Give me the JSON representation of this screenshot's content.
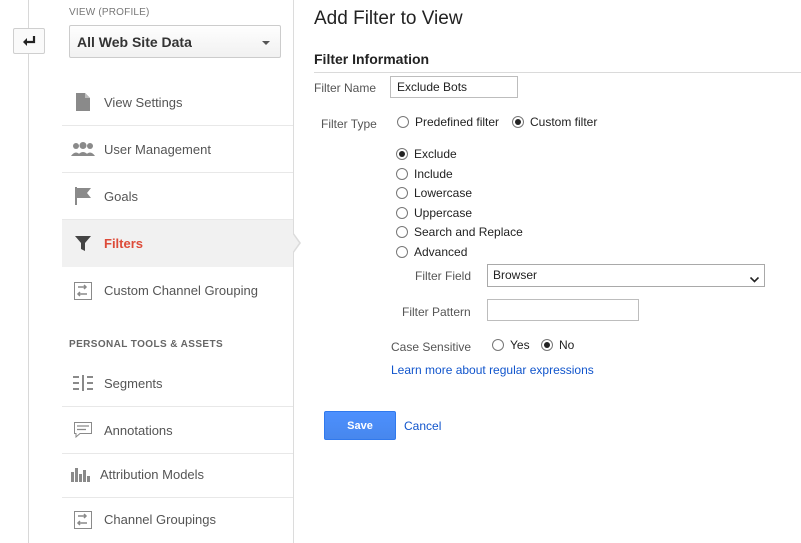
{
  "sidebar": {
    "view_label": "VIEW (PROFILE)",
    "view_selected": "All Web Site Data",
    "items": [
      {
        "label": "View Settings",
        "icon": "document-icon"
      },
      {
        "label": "User Management",
        "icon": "users-icon"
      },
      {
        "label": "Goals",
        "icon": "flag-icon"
      },
      {
        "label": "Filters",
        "icon": "funnel-icon"
      },
      {
        "label": "Custom Channel Grouping",
        "icon": "channel-grouping-icon"
      }
    ],
    "section_heading": "PERSONAL TOOLS & ASSETS",
    "tools": [
      {
        "label": "Segments",
        "icon": "segments-icon"
      },
      {
        "label": "Annotations",
        "icon": "annotation-icon"
      },
      {
        "label": "Attribution Models",
        "icon": "bar-chart-icon"
      },
      {
        "label": "Channel Groupings",
        "icon": "channel-grouping-icon"
      }
    ],
    "active_color": "#dd4b39"
  },
  "main": {
    "title": "Add Filter to View",
    "section_title": "Filter Information",
    "filter_name_label": "Filter Name",
    "filter_name_value": "Exclude Bots",
    "filter_type_label": "Filter Type",
    "filter_type_options": [
      "Predefined filter",
      "Custom filter"
    ],
    "custom_options": [
      "Exclude",
      "Include",
      "Lowercase",
      "Uppercase",
      "Search and Replace",
      "Advanced"
    ],
    "filter_field_label": "Filter Field",
    "filter_field_value": "Browser",
    "filter_pattern_label": "Filter Pattern",
    "filter_pattern_value": "",
    "case_sensitive_label": "Case Sensitive",
    "case_options": [
      "Yes",
      "No"
    ],
    "regex_link": "Learn more about regular expressions",
    "save_label": "Save",
    "cancel_label": "Cancel"
  }
}
